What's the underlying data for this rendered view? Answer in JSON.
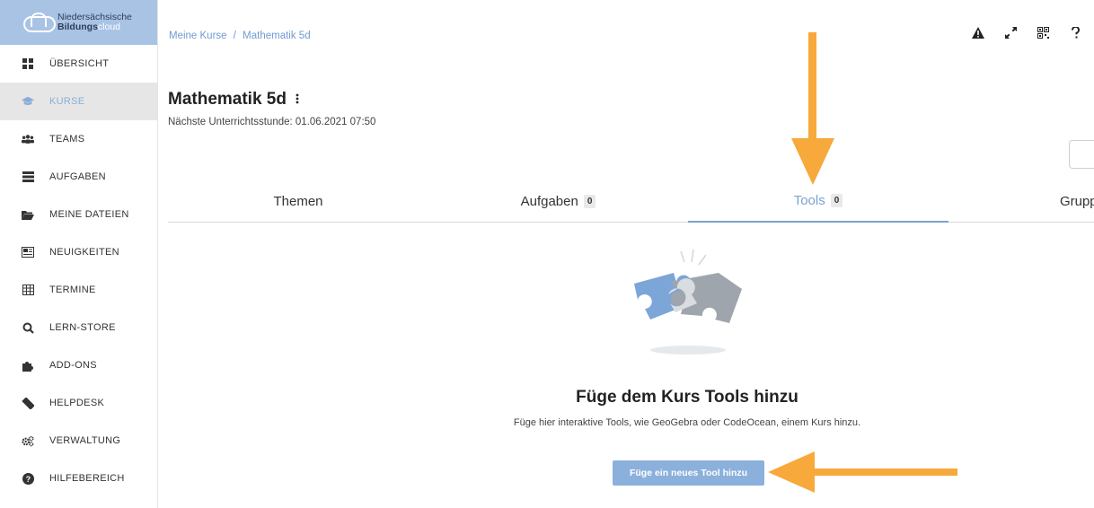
{
  "brand": {
    "line1": "Niedersächsische",
    "line2_bold": "Bildungs",
    "line2_light": "cloud"
  },
  "sidebar": {
    "items": [
      {
        "label": "ÜBERSICHT",
        "icon": "grid-icon"
      },
      {
        "label": "KURSE",
        "icon": "graduation-cap-icon",
        "active": true
      },
      {
        "label": "TEAMS",
        "icon": "users-icon"
      },
      {
        "label": "AUFGABEN",
        "icon": "tasks-icon"
      },
      {
        "label": "MEINE DATEIEN",
        "icon": "folder-icon"
      },
      {
        "label": "NEUIGKEITEN",
        "icon": "newspaper-icon"
      },
      {
        "label": "TERMINE",
        "icon": "calendar-icon"
      },
      {
        "label": "LERN-STORE",
        "icon": "search-icon"
      },
      {
        "label": "ADD-ONS",
        "icon": "puzzle-icon"
      },
      {
        "label": "HELPDESK",
        "icon": "ticket-icon"
      },
      {
        "label": "VERWALTUNG",
        "icon": "cogs-icon"
      },
      {
        "label": "HILFEBEREICH",
        "icon": "question-circle-icon"
      }
    ]
  },
  "breadcrumb": {
    "item1": "Meine Kurse",
    "separator": "/",
    "item2": "Mathematik 5d"
  },
  "top_icons": [
    "warning-icon",
    "fullscreen-icon",
    "qr-code-icon",
    "help-icon"
  ],
  "course": {
    "title": "Mathematik 5d",
    "next_lesson": "Nächste Unterrichtsstunde: 01.06.2021 07:50"
  },
  "tabs": [
    {
      "label": "Themen"
    },
    {
      "label": "Aufgaben",
      "count": "0"
    },
    {
      "label": "Tools",
      "count": "0",
      "active": true
    },
    {
      "label": "Gruppe"
    }
  ],
  "empty_state": {
    "title": "Füge dem Kurs Tools hinzu",
    "description": "Füge hier interaktive Tools, wie GeoGebra oder CodeOcean, einem Kurs hinzu.",
    "button_label": "Füge ein neues Tool hinzu"
  },
  "colors": {
    "accent": "#7aa2d2",
    "sidebar_brand": "#a9c3e5",
    "arrow": "#f7a93b",
    "button": "#8bb0dc"
  }
}
